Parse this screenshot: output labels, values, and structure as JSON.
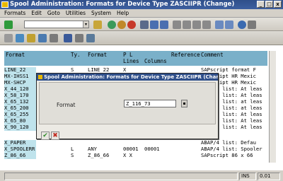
{
  "window": {
    "title": "Spool Administration: Formats for Device Type ZASCIIPR (Change)",
    "controls": [
      "_",
      "□",
      "x"
    ]
  },
  "menu": [
    "Formats",
    "Edit",
    "Goto",
    "Utilities",
    "System",
    "Help"
  ],
  "toolbar": {
    "command_value": "",
    "dropdown_glyph": "▾"
  },
  "table": {
    "headers": {
      "format": "Format",
      "ty": "Ty.",
      "format2": "Format",
      "pl": "P L",
      "lines": "Lines",
      "columns": "Columns",
      "reference": "Reference",
      "comment": "Comment"
    },
    "rows": [
      {
        "format": "LINE_22",
        "ty": "S",
        "format2": "LINE 22",
        "p": "X",
        "lines": "",
        "comment": "SAPscript format F"
      },
      {
        "format": "MX-IHSS1",
        "ty": "",
        "format2": "",
        "p": "",
        "lines": "",
        "comment": "SAPscript HR Mexic"
      },
      {
        "format": "MX-SHCP",
        "ty": "",
        "format2": "",
        "p": "",
        "lines": "",
        "comment": "SAPscript HR Mexic"
      },
      {
        "format": "X_44_120",
        "ty": "",
        "format2": "",
        "p": "",
        "lines": "",
        "comment": "ABAP/4 list: At leas"
      },
      {
        "format": "X_58_170",
        "ty": "",
        "format2": "",
        "p": "",
        "lines": "",
        "comment": "ABAP/4 list: At leas"
      },
      {
        "format": "X_65_132",
        "ty": "",
        "format2": "",
        "p": "",
        "lines": "",
        "comment": "ABAP/4 list: at leas"
      },
      {
        "format": "X_65_200",
        "ty": "",
        "format2": "",
        "p": "",
        "lines": "",
        "comment": "ABAP/4 list: at leas"
      },
      {
        "format": "X_65_255",
        "ty": "",
        "format2": "",
        "p": "",
        "lines": "",
        "comment": "ABAP/4 list: At leas"
      },
      {
        "format": "X_65_80",
        "ty": "",
        "format2": "",
        "p": "",
        "lines": "",
        "comment": "ABAP/4 list: At leas"
      },
      {
        "format": "X_90_120",
        "ty": "",
        "format2": "",
        "p": "",
        "lines": "",
        "comment": "ABAP/4 list: At leas"
      },
      {
        "format": "X_PAPER",
        "ty": "",
        "format2": "",
        "p": "",
        "lines": "",
        "comment": "ABAP/4 list: Defau"
      },
      {
        "format": "X_SPOOLERR",
        "ty": "L",
        "format2": "ANY",
        "p": "00001",
        "lines": "00001",
        "comment": "ABAP/4 list: Spooler"
      },
      {
        "format": "Z_86_66",
        "ty": "S",
        "format2": "Z_86_66",
        "p": "X X",
        "lines": "",
        "comment": "SAPscript 86 x 66"
      }
    ]
  },
  "dialog": {
    "title": "Spool Administration: Formats for Device Type ZASCIIPR (Change)",
    "field_label": "Format",
    "field_value": "Z_116_73",
    "ok_glyph": "✔",
    "cancel_glyph": "✖"
  },
  "status": {
    "mode": "INS",
    "session": "0.01"
  },
  "colors": {
    "title_bar": "#2f4f8a",
    "header_row": "#7ab0c9",
    "key_column": "#bfe3ec"
  }
}
